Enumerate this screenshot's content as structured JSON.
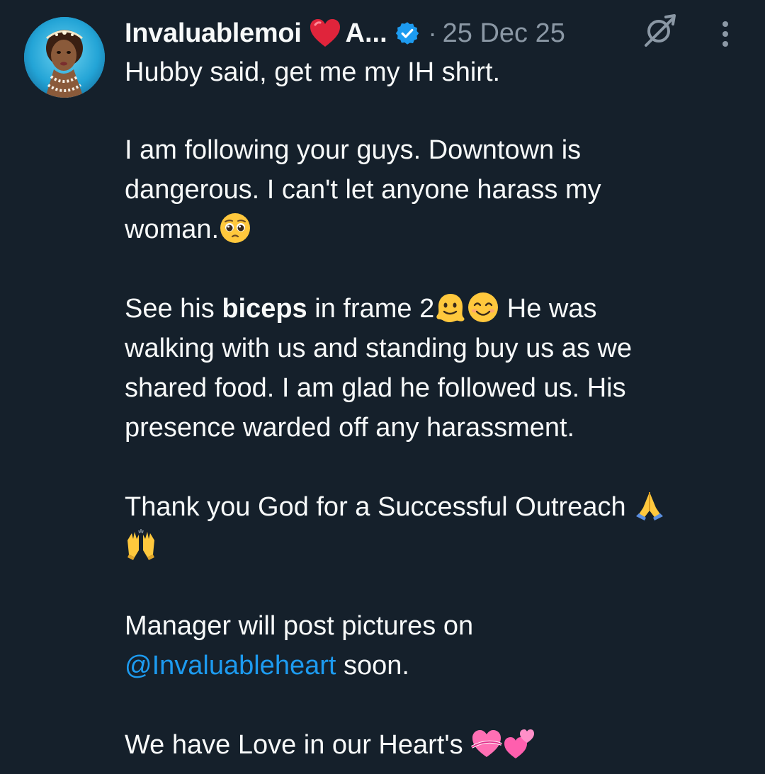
{
  "tweet": {
    "author_name": "Invaluablemoi",
    "author_name_rest": "A...",
    "separator": "·",
    "date": "25 Dec 25",
    "icons": {
      "heart": "red-heart-icon",
      "verified": "verified-badge-icon",
      "grok": "grok-icon",
      "more": "more-options-icon"
    },
    "colors": {
      "background": "#15202b",
      "text": "#f7f9f9",
      "secondary": "#8b98a5",
      "link": "#1d9bf0",
      "verified": "#1d9bf0"
    },
    "body": {
      "l1": "Hubby said, get me my IH shirt.",
      "l2": "I am following your guys. Downtown is",
      "l3": "dangerous. I can't let anyone harass my",
      "l4": "woman.",
      "l5_pre": "See his ",
      "l5_bold": "biceps",
      "l5_mid": " in frame 2",
      "l5_post": " He was",
      "l6": "walking with us and standing buy us as we",
      "l7": "shared food. I am glad he followed us. His",
      "l8": "presence warded off any harassment.",
      "l9": "Thank you God for a Successful Outreach ",
      "l11": "Manager will post pictures on",
      "l12_mention": "@Invaluableheart",
      "l12_post": " soon.",
      "l13": "We have Love in our Heart's "
    },
    "emojis": [
      "pleading-face-emoji",
      "melting-face-emoji",
      "smiling-face-emoji",
      "folded-hands-emoji",
      "raising-hands-emoji",
      "heart-with-ribbon-emoji",
      "two-hearts-emoji"
    ]
  }
}
